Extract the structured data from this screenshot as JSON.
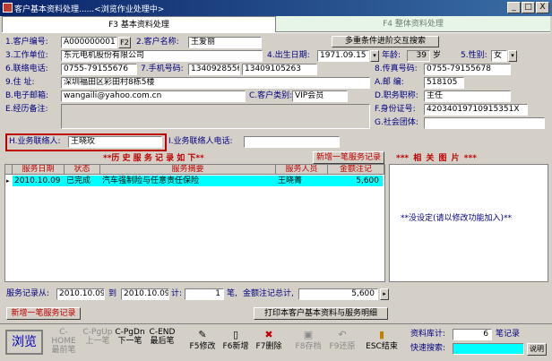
{
  "window": {
    "title": "客户基本资料处理......<浏览作业处理中>",
    "minimize": "_",
    "maximize": "□",
    "close": "X"
  },
  "tabs": [
    {
      "label": "F3 基本资料处理"
    },
    {
      "label": "F4 整体资料处理"
    }
  ],
  "form": {
    "cust_no": {
      "label": "1.客户编号:",
      "value": "A000000001",
      "btn": "F2"
    },
    "cust_name": {
      "label": "2.客户名称:",
      "value": "王爱丽"
    },
    "multi_search": {
      "label": "多重条件进阶交互搜索"
    },
    "company": {
      "label": "3.工作单位:",
      "value": "东元电机股份有限公司"
    },
    "birth": {
      "label": "4.出生日期:",
      "value": "1971.09.15"
    },
    "age": {
      "label": "年龄:",
      "value": "39",
      "unit": "岁"
    },
    "gender": {
      "label": "5.性别:",
      "value": "女"
    },
    "phone": {
      "label": "6.联络电话:",
      "value": "0755-79155676"
    },
    "mobile": {
      "label": "7.手机号码:",
      "value": "13409285569",
      "value2": "13409105263"
    },
    "fax": {
      "label": "8.传真号码:",
      "value": "0755-79155678"
    },
    "address": {
      "label": "9.住    址:",
      "value": "深圳福田区彩田村8栋5楼"
    },
    "zip": {
      "label": "A.邮    编:",
      "value": "518105"
    },
    "email": {
      "label": "B.电子邮箱:",
      "value": "wangaili@yahoo.com.cn"
    },
    "cust_type": {
      "label": "C.客户类别:",
      "value": "VIP会员"
    },
    "job": {
      "label": "D.职务职称:",
      "value": "主任"
    },
    "notes": {
      "label": "E.经历备注:",
      "value": ""
    },
    "id_no": {
      "label": "F.身份证号:",
      "value": "42034019710915351X"
    },
    "group": {
      "label": "G.社会团体:",
      "value": ""
    },
    "contact": {
      "label": "H.业务联络人:",
      "value": "王晓玫"
    },
    "contact_phone": {
      "label": "I.业务联络人电话:",
      "value": ""
    }
  },
  "history": {
    "title": "**历 史 服 务 记 录 如 下**",
    "add_btn": "新增一笔服务记录",
    "columns": [
      "服务日期",
      "状态",
      "服务摘要",
      "服务人员",
      "金额注记"
    ],
    "rows": [
      {
        "date": "2010.10.09",
        "status": "已完成",
        "summary": "汽车强制险与任意责任保险",
        "staff": "王晓菁",
        "amount": "5,600"
      }
    ]
  },
  "pictures": {
    "title": "***  相 关 图 片  ***",
    "empty": "**没设定(请以修改功能加入)**"
  },
  "summary": {
    "range_label": "服务记录从:",
    "from": "2010.10.09",
    "to_label": "到",
    "to": "2010.10.09",
    "count_label": "计:",
    "count": "1",
    "count_unit": "笔,",
    "amount_label": "金额注记总计,",
    "amount": "5,600"
  },
  "actions": {
    "add_record": "新增一笔服务记录",
    "print": "打印本客户基本资料与服务明细"
  },
  "toolbar": {
    "browse": "浏览",
    "buttons": [
      {
        "l1": "C-HOME",
        "l2": "最前笔",
        "disabled": true
      },
      {
        "l1": "C-PgUp",
        "l2": "上一笔",
        "disabled": true
      },
      {
        "l1": "C-PgDn",
        "l2": "下一笔",
        "disabled": false
      },
      {
        "l1": "C-END",
        "l2": "最后笔",
        "disabled": false
      },
      {
        "l1": "F5修改",
        "disabled": false
      },
      {
        "l1": "F6新增",
        "disabled": false
      },
      {
        "l1": "F7删除",
        "disabled": false
      },
      {
        "l1": "F8存档",
        "disabled": true
      },
      {
        "l1": "F9还原",
        "disabled": true
      },
      {
        "l1": "ESC结束",
        "disabled": false
      }
    ],
    "db_count_label": "资料库计:",
    "db_count": "6",
    "db_count_unit": "笔记录",
    "quick_search_label": "快速搜索:",
    "quick_search_value": "",
    "help": "说明"
  },
  "colors": {
    "title_bar": "#0a246a",
    "highlight_row": "#00ffff",
    "label_blue": "#000080",
    "label_red": "#c00000",
    "active_tab": "#ffffff",
    "inactive_tab": "#e6f5e6",
    "contact_box": "#c00000"
  }
}
